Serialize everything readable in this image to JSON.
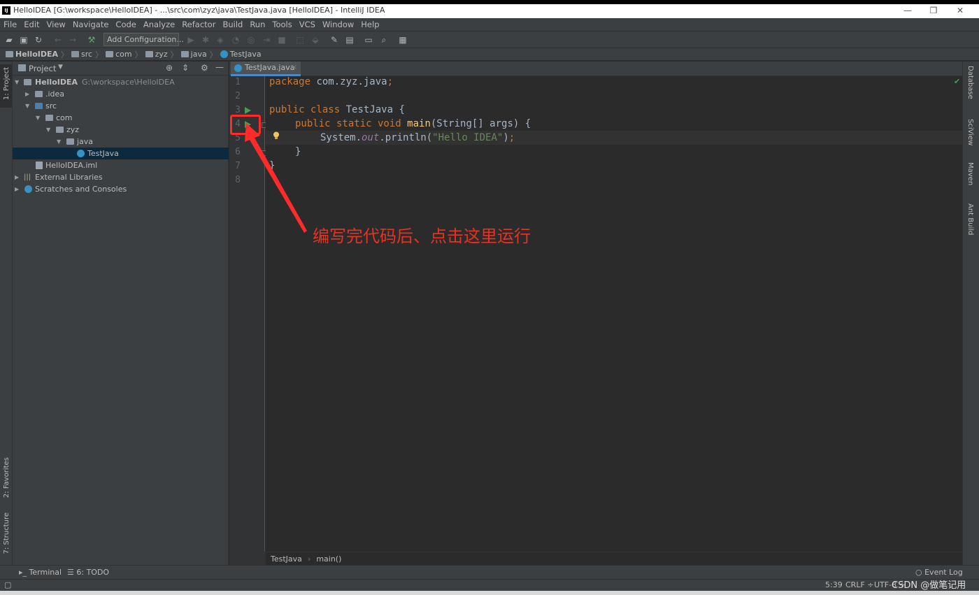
{
  "window": {
    "app_icon": "IJ",
    "title": "HelloIDEA [G:\\workspace\\HelloIDEA] - ...\\src\\com\\zyz\\java\\TestJava.java [HelloIDEA] - IntelliJ IDEA",
    "minimize": "—",
    "restore": "❐",
    "close": "✕"
  },
  "menu": [
    "File",
    "Edit",
    "View",
    "Navigate",
    "Code",
    "Analyze",
    "Refactor",
    "Build",
    "Run",
    "Tools",
    "VCS",
    "Window",
    "Help"
  ],
  "toolbar": {
    "add_configuration": "Add Configuration..."
  },
  "breadcrumb": [
    "HelloIDEA",
    "src",
    "com",
    "zyz",
    "java",
    "TestJava"
  ],
  "left_strip": {
    "project": "1: Project",
    "favorites": "2: Favorites",
    "structure": "7: Structure"
  },
  "project_panel": {
    "title": "Project",
    "tree": [
      {
        "label": "HelloIDEA",
        "path": "G:\\workspace\\HelloIDEA"
      },
      {
        "label": ".idea"
      },
      {
        "label": "src"
      },
      {
        "label": "com"
      },
      {
        "label": "zyz"
      },
      {
        "label": "java"
      },
      {
        "label": "TestJava"
      },
      {
        "label": "HelloIDEA.iml"
      },
      {
        "label": "External Libraries"
      },
      {
        "label": "Scratches and Consoles"
      }
    ]
  },
  "editor": {
    "tab": "TestJava.java",
    "tab_close": "×",
    "line_numbers": [
      "1",
      "2",
      "3",
      "4",
      "5",
      "6",
      "7",
      "8"
    ],
    "code": {
      "l1_kw": "package",
      "l1_rest": " com.zyz.java",
      "l1_semi": ";",
      "l3_kw": "public class",
      "l3_rest": " TestJava {",
      "l4_kw1": "public static void",
      "l4_fn": "main",
      "l4_rest": "(String[] args) {",
      "l5_a": "System.",
      "l5_out": "out",
      "l5_b": ".println(",
      "l5_str": "\"Hello IDEA\"",
      "l5_c": ")",
      "l5_semi": ";",
      "l6": "}",
      "l7": "}"
    },
    "breadcrumb": [
      "TestJava",
      "main()"
    ]
  },
  "annotation": "编写完代码后、点击这里运行",
  "right_strip": [
    "Database",
    "SciView",
    "Maven",
    "Ant Build"
  ],
  "bottom_tools": {
    "terminal": "Terminal",
    "todo": "6: TODO",
    "event_log": "Event Log"
  },
  "status": {
    "position": "5:39",
    "line_sep": "CRLF ÷",
    "encoding": "UTF-8 ÷"
  },
  "watermark": "CSDN @做笔记用",
  "colors": {
    "background": "#2b2b2b",
    "panel": "#3c3f41",
    "keyword": "#cc7832",
    "function": "#ffc66d",
    "string": "#6a8759",
    "run_icon": "#499c54",
    "annotation": "#e53323"
  }
}
